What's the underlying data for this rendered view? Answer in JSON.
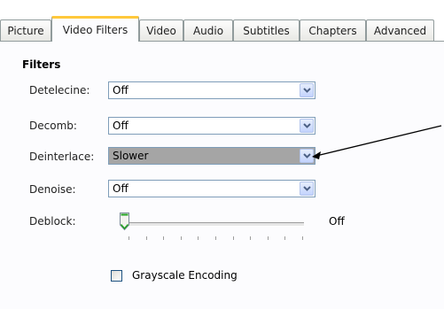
{
  "tabs": [
    {
      "label": "Picture",
      "active": false
    },
    {
      "label": "Video Filters",
      "active": true
    },
    {
      "label": "Video",
      "active": false
    },
    {
      "label": "Audio",
      "active": false
    },
    {
      "label": "Subtitles",
      "active": false
    },
    {
      "label": "Chapters",
      "active": false
    },
    {
      "label": "Advanced",
      "active": false
    }
  ],
  "filters": {
    "title": "Filters",
    "detelecine": {
      "label": "Detelecine:",
      "value": "Off"
    },
    "decomb": {
      "label": "Decomb:",
      "value": "Off"
    },
    "deinterlace": {
      "label": "Deinterlace:",
      "value": "Slower"
    },
    "denoise": {
      "label": "Denoise:",
      "value": "Off"
    },
    "deblock": {
      "label": "Deblock:",
      "value_text": "Off",
      "level": 0
    },
    "grayscale": {
      "label": "Grayscale Encoding",
      "checked": false
    }
  },
  "colors": {
    "active_tab_accent": "#ffc83c",
    "combo_border": "#7f9db9",
    "selected_combo_bg": "#a5a5a5"
  }
}
